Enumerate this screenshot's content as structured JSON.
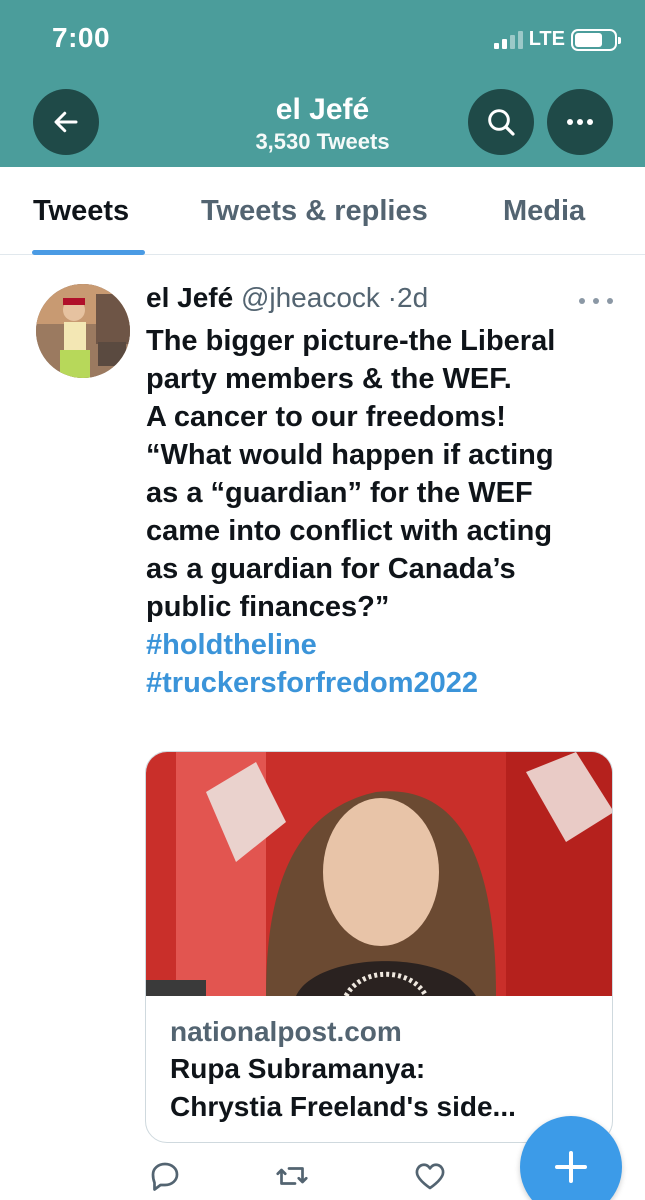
{
  "status_bar": {
    "time": "7:00",
    "network": "LTE"
  },
  "header": {
    "title": "el Jefé",
    "subtitle": "3,530 Tweets"
  },
  "tabs": [
    {
      "label": "Tweets",
      "active": true
    },
    {
      "label": "Tweets & replies",
      "active": false
    },
    {
      "label": "Media",
      "active": false
    }
  ],
  "tweet": {
    "author_name": "el Jefé",
    "handle": "@jheacock",
    "separator": "·",
    "time": "2d",
    "text_lines": [
      "The bigger picture-the Liberal",
      "party members & the WEF.",
      "A cancer to our freedoms!",
      "“What would happen if acting",
      "as a “guardian” for the WEF",
      "came into conflict with acting",
      "as a guardian for Canada’s",
      "public finances?”"
    ],
    "hashtags": [
      "#holdtheline",
      "#truckersforfredom2022"
    ],
    "link_card": {
      "domain": "nationalpost.com",
      "title_line1": "Rupa Subramanya:",
      "title_line2": "Chrystia Freeland's side..."
    }
  },
  "colors": {
    "header_bg": "#4b9d9b",
    "accent": "#3b94d9",
    "fab": "#3c9be8"
  },
  "icons": [
    "back-arrow-icon",
    "search-icon",
    "more-icon",
    "reply-icon",
    "retweet-icon",
    "like-icon",
    "compose-plus-icon"
  ]
}
